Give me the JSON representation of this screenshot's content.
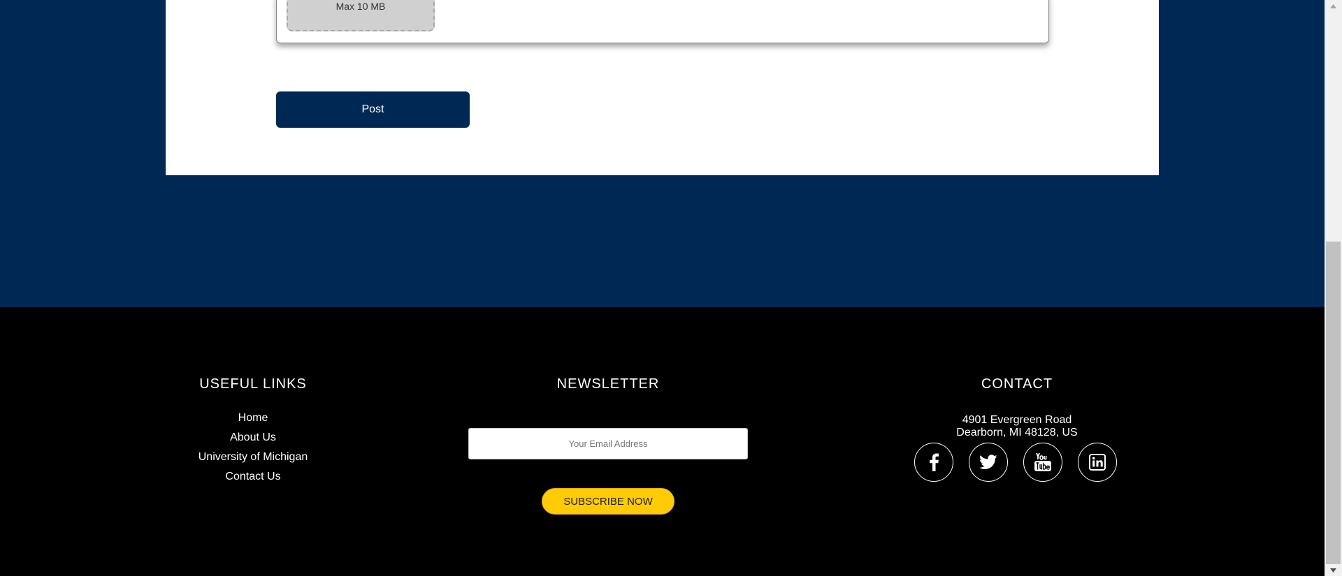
{
  "upload": {
    "max_size": "Max 10 MB"
  },
  "form": {
    "post_label": "Post"
  },
  "footer": {
    "useful_links": {
      "heading": "USEFUL LINKS",
      "items": [
        {
          "label": "Home"
        },
        {
          "label": "About Us"
        },
        {
          "label": "University of Michigan"
        },
        {
          "label": "Contact Us"
        }
      ]
    },
    "newsletter": {
      "heading": "NEWSLETTER",
      "email_placeholder": "Your Email Address",
      "email_value": "",
      "subscribe_label": "SUBSCRIBE NOW"
    },
    "contact": {
      "heading": "CONTACT",
      "address_line1": "4901 Evergreen Road",
      "address_line2": "Dearborn, MI 48128, US",
      "social": [
        {
          "name": "facebook",
          "icon": "facebook-icon"
        },
        {
          "name": "twitter",
          "icon": "twitter-icon"
        },
        {
          "name": "youtube",
          "icon": "youtube-icon"
        },
        {
          "name": "linkedin",
          "icon": "linkedin-icon"
        }
      ]
    }
  },
  "colors": {
    "brand_blue": "#002855",
    "accent_maize": "#ffcb05",
    "footer_bg": "#000000"
  }
}
